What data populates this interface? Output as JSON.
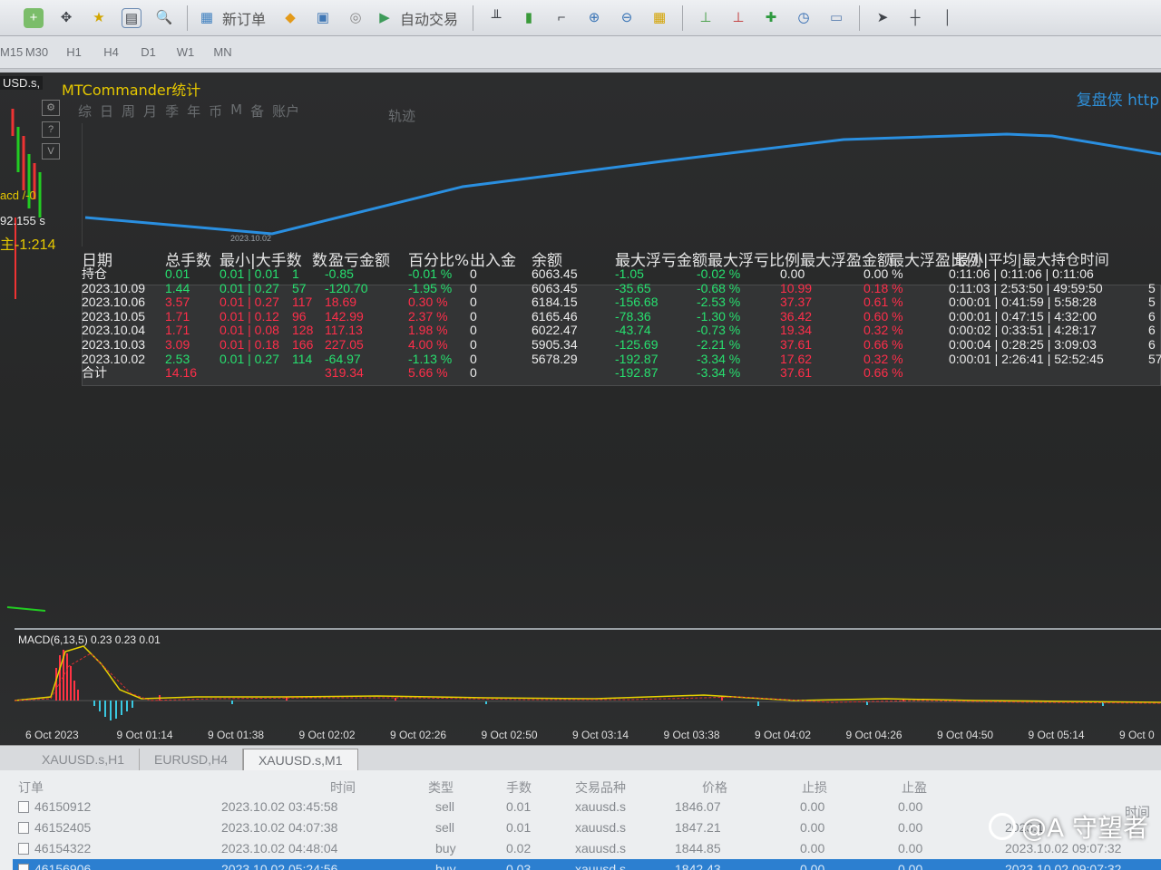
{
  "toolbar": {
    "new_order": "新订单",
    "auto_trading": "自动交易"
  },
  "periods": [
    "M15",
    "M30",
    "H1",
    "H4",
    "D1",
    "W1",
    "MN"
  ],
  "chart": {
    "symbol_label": "USD.s,",
    "side_text_1": "acd /-0",
    "side_text_2": "92.155 s",
    "side_text_3": "主-1:214"
  },
  "panel": {
    "title": "MTCommander统计",
    "link": "复盘侠 http",
    "tabs": [
      "综",
      "日",
      "周",
      "月",
      "季",
      "年",
      "币",
      "M",
      "备",
      "账户"
    ],
    "track_tab": "轨迹",
    "equity_date_label": "2023.10.02"
  },
  "stats": {
    "headers": {
      "date": "日期",
      "total_lots": "总手数",
      "min_max_lots": "最小|大手数",
      "count": "数",
      "pnl_amount": "盈亏金额",
      "percent": "百分比%",
      "deposit": "出入金",
      "balance": "余额",
      "max_float_loss": "最大浮亏金额",
      "max_float_loss_pct": "最大浮亏比例",
      "max_float_profit": "最大浮盈金额",
      "max_float_profit_pct": "最大浮盈比例",
      "hold_time": "最小|平均|最大持仓时间"
    },
    "rows": [
      {
        "date": "持仓",
        "lots": "0.01",
        "minmax": "0.01 | 0.01",
        "count": "1",
        "pnl": "-0.85",
        "pct": "-0.01 %",
        "dep": "0",
        "bal": "6063.45",
        "mfl": "-1.05",
        "mflp": "-0.02 %",
        "mfp": "0.00",
        "mfpp": "0.00 %",
        "hold": "0:11:06 | 0:11:06 | 0:11:06",
        "extra": ""
      },
      {
        "date": "2023.10.09",
        "lots": "1.44",
        "minmax": "0.01 | 0.27",
        "count": "57",
        "pnl": "-120.70",
        "pct": "-1.95 %",
        "dep": "0",
        "bal": "6063.45",
        "mfl": "-35.65",
        "mflp": "-0.68 %",
        "mfp": "10.99",
        "mfpp": "0.18 %",
        "hold": "0:11:03 | 2:53:50 | 49:59:50",
        "extra": "5"
      },
      {
        "date": "2023.10.06",
        "lots": "3.57",
        "minmax": "0.01 | 0.27",
        "count": "117",
        "pnl": "18.69",
        "pct": "0.30 %",
        "dep": "0",
        "bal": "6184.15",
        "mfl": "-156.68",
        "mflp": "-2.53 %",
        "mfp": "37.37",
        "mfpp": "0.61 %",
        "hold": "0:00:01 | 0:41:59 | 5:58:28",
        "extra": "5"
      },
      {
        "date": "2023.10.05",
        "lots": "1.71",
        "minmax": "0.01 | 0.12",
        "count": "96",
        "pnl": "142.99",
        "pct": "2.37 %",
        "dep": "0",
        "bal": "6165.46",
        "mfl": "-78.36",
        "mflp": "-1.30 %",
        "mfp": "36.42",
        "mfpp": "0.60 %",
        "hold": "0:00:01 | 0:47:15 | 4:32:00",
        "extra": "6"
      },
      {
        "date": "2023.10.04",
        "lots": "1.71",
        "minmax": "0.01 | 0.08",
        "count": "128",
        "pnl": "117.13",
        "pct": "1.98 %",
        "dep": "0",
        "bal": "6022.47",
        "mfl": "-43.74",
        "mflp": "-0.73 %",
        "mfp": "19.34",
        "mfpp": "0.32 %",
        "hold": "0:00:02 | 0:33:51 | 4:28:17",
        "extra": "6"
      },
      {
        "date": "2023.10.03",
        "lots": "3.09",
        "minmax": "0.01 | 0.18",
        "count": "166",
        "pnl": "227.05",
        "pct": "4.00 %",
        "dep": "0",
        "bal": "5905.34",
        "mfl": "-125.69",
        "mflp": "-2.21 %",
        "mfp": "37.61",
        "mfpp": "0.66 %",
        "hold": "0:00:04 | 0:28:25 | 3:09:03",
        "extra": "6"
      },
      {
        "date": "2023.10.02",
        "lots": "2.53",
        "minmax": "0.01 | 0.27",
        "count": "114",
        "pnl": "-64.97",
        "pct": "-1.13 %",
        "dep": "0",
        "bal": "5678.29",
        "mfl": "-192.87",
        "mflp": "-3.34 %",
        "mfp": "17.62",
        "mfpp": "0.32 %",
        "hold": "0:00:01 | 2:26:41 | 52:52:45",
        "extra": "57"
      },
      {
        "date": "合计",
        "lots": "14.16",
        "minmax": "",
        "count": "",
        "pnl": "319.34",
        "pct": "5.66 %",
        "dep": "0",
        "bal": "",
        "mfl": "-192.87",
        "mflp": "-3.34 %",
        "mfp": "37.61",
        "mfpp": "0.66 %",
        "hold": "",
        "extra": ""
      }
    ]
  },
  "macd": {
    "label": "MACD(6,13,5) 0.23 0.23 0.01"
  },
  "time_axis": [
    "6 Oct 2023",
    "9 Oct 01:14",
    "9 Oct 01:38",
    "9 Oct 02:02",
    "9 Oct 02:26",
    "9 Oct 02:50",
    "9 Oct 03:14",
    "9 Oct 03:38",
    "9 Oct 04:02",
    "9 Oct 04:26",
    "9 Oct 04:50",
    "9 Oct 05:14",
    "9 Oct 0"
  ],
  "bottom_tabs": [
    "XAUUSD.s,H1",
    "EURUSD,H4",
    "XAUUSD.s,M1"
  ],
  "trade_table": {
    "headers": {
      "order": "订单",
      "time": "时间",
      "type": "类型",
      "lots": "手数",
      "symbol": "交易品种",
      "price": "价格",
      "sl": "止损",
      "tp": "止盈",
      "time2": "时间"
    },
    "rows": [
      {
        "order": "46150912",
        "time": "2023.10.02 03:45:58",
        "type": "sell",
        "lots": "0.01",
        "symbol": "xauusd.s",
        "price": "1846.07",
        "sl": "0.00",
        "tp": "0.00",
        "time2": ""
      },
      {
        "order": "46152405",
        "time": "2023.10.02 04:07:38",
        "type": "sell",
        "lots": "0.01",
        "symbol": "xauusd.s",
        "price": "1847.21",
        "sl": "0.00",
        "tp": "0.00",
        "time2": "2023.1"
      },
      {
        "order": "46154322",
        "time": "2023.10.02 04:48:04",
        "type": "buy",
        "lots": "0.02",
        "symbol": "xauusd.s",
        "price": "1844.85",
        "sl": "0.00",
        "tp": "0.00",
        "time2": "2023.10.02 09:07:32"
      },
      {
        "order": "46156906",
        "time": "2023.10.02 05:24:56",
        "type": "buy",
        "lots": "0.03",
        "symbol": "xauusd.s",
        "price": "1842.43",
        "sl": "0.00",
        "tp": "0.00",
        "time2": "2023.10.02 09:07:32"
      }
    ]
  },
  "watermark": "@A 守望者",
  "colors": {
    "profit": "#27e06f",
    "loss": "#ff2e4a",
    "equity_line": "#2a8fe0",
    "title": "#e6c800"
  }
}
